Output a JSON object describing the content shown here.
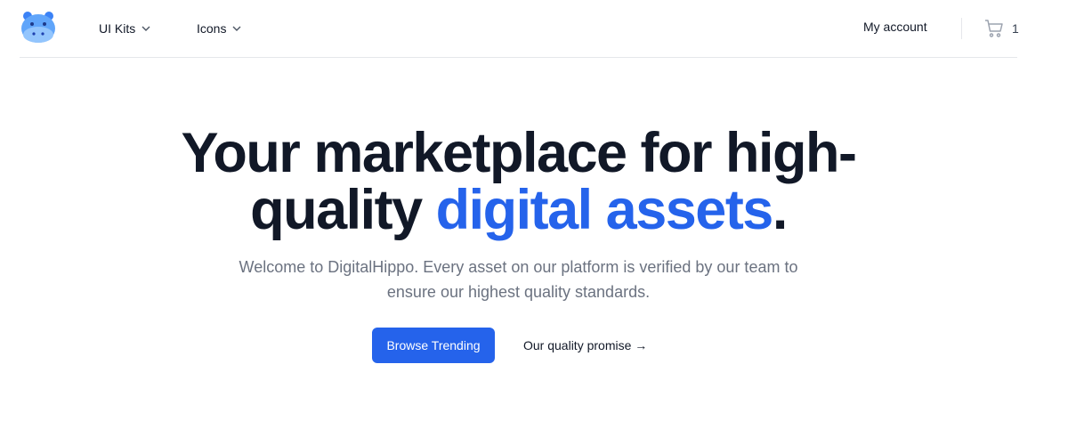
{
  "nav": {
    "logo_icon": "hippo-logo-icon",
    "items": [
      {
        "label": "UI Kits",
        "icon": "chevron-down-icon"
      },
      {
        "label": "Icons",
        "icon": "chevron-down-icon"
      }
    ],
    "account_label": "My account",
    "cart_icon": "cart-icon",
    "cart_count": "1"
  },
  "hero": {
    "title_part1": "Your marketplace for high-quality ",
    "title_highlight": "digital assets",
    "title_end": ".",
    "subtitle": "Welcome to DigitalHippo. Every asset on our platform is verified by our team to ensure our highest quality standards.",
    "primary_button": "Browse Trending",
    "secondary_button": "Our quality promise →"
  },
  "colors": {
    "accent": "#2563eb",
    "text": "#111827",
    "muted": "#6b7280",
    "border": "#e5e7eb"
  }
}
